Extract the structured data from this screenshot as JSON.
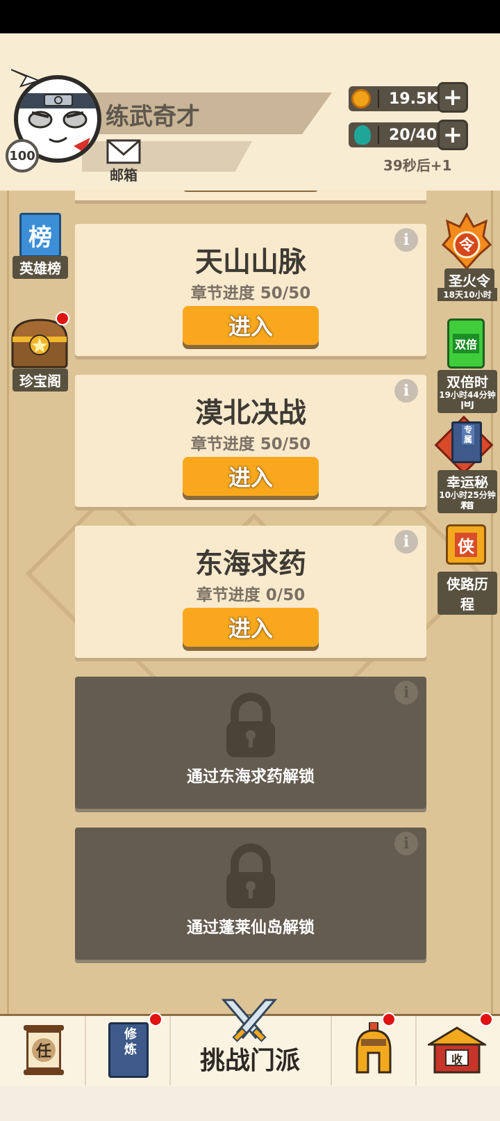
{
  "header": {
    "level": "100",
    "player_name": "练武奇才",
    "mail_label": "邮箱",
    "copper": "19.5K",
    "energy": "20/40",
    "energy_timer": "39秒后+1"
  },
  "left_side": [
    {
      "label": "英雄榜",
      "icon": "ranking-board-icon",
      "icon_text": "榜"
    },
    {
      "label": "珍宝阁",
      "icon": "treasure-chest-icon"
    }
  ],
  "right_side": [
    {
      "label": "圣火令",
      "sub": "18天10小时",
      "icon": "flame-token-icon",
      "icon_text": "令"
    },
    {
      "label": "双倍时间",
      "sub": "19小时44分钟",
      "icon": "double-ticket-icon",
      "icon_text": "双倍"
    },
    {
      "label": "幸运秘籍",
      "sub": "10小时25分钟",
      "icon": "secret-book-icon",
      "icon_text": "专属"
    },
    {
      "label": "侠路历程",
      "icon": "hero-path-icon",
      "icon_text": "侠"
    }
  ],
  "chapters": [
    {
      "title": "天山山脉",
      "progress": "章节进度 50/50",
      "button": "进入"
    },
    {
      "title": "漠北决战",
      "progress": "章节进度 50/50",
      "button": "进入"
    },
    {
      "title": "东海求药",
      "progress": "章节进度 0/50",
      "button": "进入"
    }
  ],
  "locked": [
    {
      "text": "通过东海求药解锁"
    },
    {
      "text": "通过蓬莱仙岛解锁"
    }
  ],
  "bottom_nav": {
    "task_icon_text": "任",
    "train_icon_text": "修炼",
    "challenge_label": "挑战门派",
    "collect_icon_text": "收"
  },
  "colors": {
    "accent_button": "#f9a81d",
    "notification": "#e01212",
    "card_bg": "#f9eacd",
    "locked_bg": "#655c50"
  }
}
